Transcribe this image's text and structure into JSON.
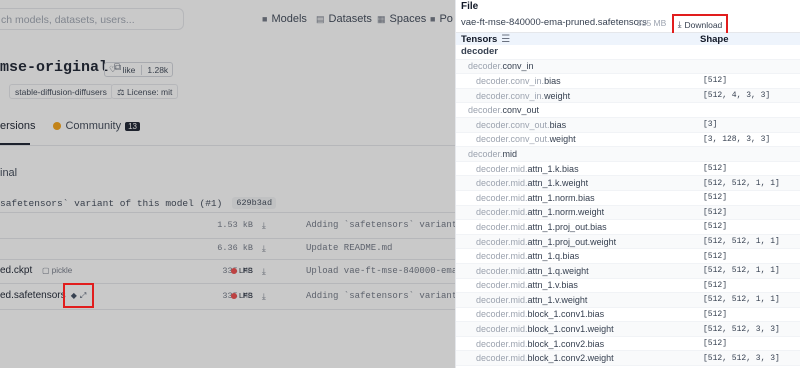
{
  "background": {
    "search_placeholder": "ch models, datasets, users...",
    "nav": [
      {
        "icon": "models-icon",
        "label": "Models"
      },
      {
        "icon": "datasets-icon",
        "label": "Datasets"
      },
      {
        "icon": "spaces-icon",
        "label": "Spaces"
      },
      {
        "icon": "posts-icon",
        "label": "Po"
      }
    ],
    "repo_title": "mse-original",
    "like_label": "like",
    "like_count": "1.28k",
    "tags": [
      "stable-diffusion-diffusers",
      "License: mit"
    ],
    "tabs": {
      "versions": "ersions",
      "community": "Community",
      "community_count": "13"
    },
    "branch": "inal",
    "commit_message": "safetensors` variant of this model (#1)",
    "commit_sha": "629b3ad",
    "files": [
      {
        "name": "",
        "size": "1.53 kB",
        "message": "Adding `safetensors` variant o",
        "lfs": false,
        "pickle": false
      },
      {
        "name": "",
        "size": "6.36 kB",
        "message": "Update README.md",
        "lfs": false,
        "pickle": false
      },
      {
        "name": "ed.ckpt",
        "size": "335 MB",
        "message": "Upload vae-ft-mse-840000-ema-p",
        "lfs": true,
        "pickle": true,
        "pickle_label": "pickle"
      },
      {
        "name": "ed.safetensors",
        "size": "335 MB",
        "message": "Adding `safetensors` variant o",
        "lfs": true,
        "pickle": false
      }
    ],
    "lfs_label": "LFS"
  },
  "panel": {
    "header": "File",
    "filename": "vae-ft-mse-840000-ema-pruned.safetensors",
    "filesize": "335 MB",
    "download_label": "Download",
    "col_tensors": "Tensors",
    "col_shape": "Shape",
    "rows": [
      {
        "level": 0,
        "prefix": "",
        "name": "decoder",
        "shape": ""
      },
      {
        "level": 1,
        "prefix": "decoder.",
        "name": "conv_in",
        "shape": ""
      },
      {
        "level": 2,
        "prefix": "decoder.conv_in.",
        "name": "bias",
        "shape": "[512]"
      },
      {
        "level": 2,
        "prefix": "decoder.conv_in.",
        "name": "weight",
        "shape": "[512, 4, 3, 3]"
      },
      {
        "level": 1,
        "prefix": "decoder.",
        "name": "conv_out",
        "shape": ""
      },
      {
        "level": 2,
        "prefix": "decoder.conv_out.",
        "name": "bias",
        "shape": "[3]"
      },
      {
        "level": 2,
        "prefix": "decoder.conv_out.",
        "name": "weight",
        "shape": "[3, 128, 3, 3]"
      },
      {
        "level": 1,
        "prefix": "decoder.",
        "name": "mid",
        "shape": ""
      },
      {
        "level": 2,
        "prefix": "decoder.mid.",
        "name": "attn_1.k.bias",
        "shape": "[512]"
      },
      {
        "level": 2,
        "prefix": "decoder.mid.",
        "name": "attn_1.k.weight",
        "shape": "[512, 512, 1, 1]"
      },
      {
        "level": 2,
        "prefix": "decoder.mid.",
        "name": "attn_1.norm.bias",
        "shape": "[512]"
      },
      {
        "level": 2,
        "prefix": "decoder.mid.",
        "name": "attn_1.norm.weight",
        "shape": "[512]"
      },
      {
        "level": 2,
        "prefix": "decoder.mid.",
        "name": "attn_1.proj_out.bias",
        "shape": "[512]"
      },
      {
        "level": 2,
        "prefix": "decoder.mid.",
        "name": "attn_1.proj_out.weight",
        "shape": "[512, 512, 1, 1]"
      },
      {
        "level": 2,
        "prefix": "decoder.mid.",
        "name": "attn_1.q.bias",
        "shape": "[512]"
      },
      {
        "level": 2,
        "prefix": "decoder.mid.",
        "name": "attn_1.q.weight",
        "shape": "[512, 512, 1, 1]"
      },
      {
        "level": 2,
        "prefix": "decoder.mid.",
        "name": "attn_1.v.bias",
        "shape": "[512]"
      },
      {
        "level": 2,
        "prefix": "decoder.mid.",
        "name": "attn_1.v.weight",
        "shape": "[512, 512, 1, 1]"
      },
      {
        "level": 2,
        "prefix": "decoder.mid.",
        "name": "block_1.conv1.bias",
        "shape": "[512]"
      },
      {
        "level": 2,
        "prefix": "decoder.mid.",
        "name": "block_1.conv1.weight",
        "shape": "[512, 512, 3, 3]"
      },
      {
        "level": 2,
        "prefix": "decoder.mid.",
        "name": "block_1.conv2.bias",
        "shape": "[512]"
      },
      {
        "level": 2,
        "prefix": "decoder.mid.",
        "name": "block_1.conv2.weight",
        "shape": "[512, 512, 3, 3]"
      }
    ]
  }
}
